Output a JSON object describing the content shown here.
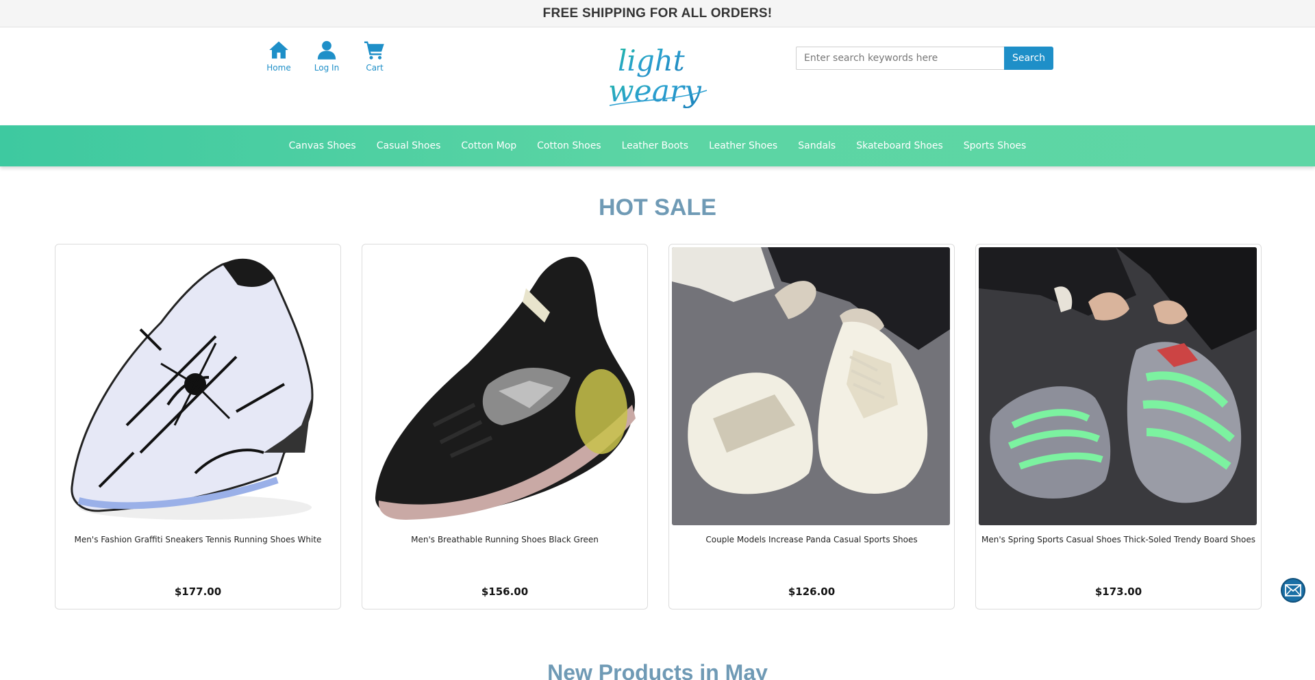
{
  "banner": {
    "text": "FREE SHIPPING FOR ALL ORDERS!"
  },
  "header": {
    "icons": [
      {
        "label": "Home",
        "icon": "home-icon"
      },
      {
        "label": "Log In",
        "icon": "user-icon"
      },
      {
        "label": "Cart",
        "icon": "cart-icon"
      }
    ],
    "logo": {
      "line1": "light",
      "line2": "weary"
    },
    "search": {
      "placeholder": "Enter search keywords here",
      "button_label": "Search"
    }
  },
  "nav": {
    "items": [
      "Canvas Shoes",
      "Casual Shoes",
      "Cotton Mop",
      "Cotton Shoes",
      "Leather Boots",
      "Leather Shoes",
      "Sandals",
      "Skateboard Shoes",
      "Sports Shoes"
    ]
  },
  "hot_sale": {
    "title": "HOT SALE",
    "products": [
      {
        "name": "Men's Fashion Graffiti Sneakers Tennis Running Shoes White",
        "price": "$177.00",
        "image": "white-graffiti-sneaker"
      },
      {
        "name": "Men's Breathable Running Shoes Black Green",
        "price": "$156.00",
        "image": "black-running-shoe"
      },
      {
        "name": "Couple Models Increase Panda Casual Sports Shoes",
        "price": "$126.00",
        "image": "white-chunky-sneakers"
      },
      {
        "name": "Men's Spring Sports Casual Shoes Thick-Soled Trendy Board Shoes",
        "price": "$173.00",
        "image": "green-glow-sneakers"
      }
    ]
  },
  "new_products": {
    "title": "New Products in May"
  },
  "colors": {
    "accent": "#1e8fc8",
    "nav_green": "#5cd5a4",
    "heading": "#6f9ab5"
  }
}
